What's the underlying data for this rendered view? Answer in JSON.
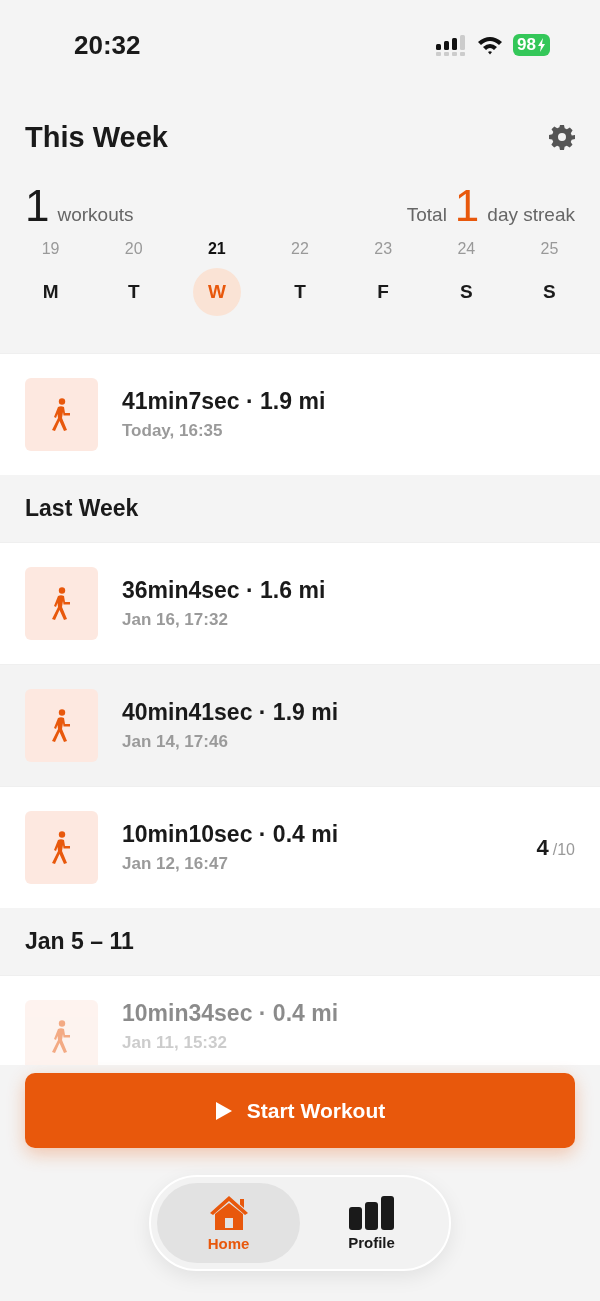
{
  "status_bar": {
    "time": "20:32",
    "battery": "98"
  },
  "header": {
    "title": "This Week",
    "workouts_count": "1",
    "workouts_label": "workouts",
    "streak_prefix": "Total",
    "streak_count": "1",
    "streak_label": "day streak"
  },
  "week": [
    {
      "date": "19",
      "day": "M",
      "selected": false
    },
    {
      "date": "20",
      "day": "T",
      "selected": false
    },
    {
      "date": "21",
      "day": "W",
      "selected": true
    },
    {
      "date": "22",
      "day": "T",
      "selected": false
    },
    {
      "date": "23",
      "day": "F",
      "selected": false
    },
    {
      "date": "24",
      "day": "S",
      "selected": false
    },
    {
      "date": "25",
      "day": "S",
      "selected": false
    }
  ],
  "sections": [
    {
      "workouts": [
        {
          "summary": "41min7sec · 1.9 mi",
          "when": "Today, 16:35",
          "highlighted": false
        }
      ]
    },
    {
      "title": "Last Week",
      "workouts": [
        {
          "summary": "36min4sec · 1.6 mi",
          "when": "Jan 16, 17:32",
          "highlighted": false
        },
        {
          "summary": "40min41sec · 1.9 mi",
          "when": "Jan 14, 17:46",
          "highlighted": true
        },
        {
          "summary": "10min10sec · 0.4 mi",
          "when": "Jan 12, 16:47",
          "highlighted": false,
          "score": "4",
          "score_max": "/10"
        }
      ]
    },
    {
      "title": "Jan 5 – 11",
      "workouts": [
        {
          "summary": "10min34sec · 0.4 mi",
          "when": "Jan 11, 15:32",
          "highlighted": false
        }
      ]
    }
  ],
  "start_button": {
    "label": "Start Workout"
  },
  "tabs": [
    {
      "label": "Home",
      "kind": "home",
      "selected": true
    },
    {
      "label": "Profile",
      "kind": "stats",
      "selected": false
    }
  ]
}
